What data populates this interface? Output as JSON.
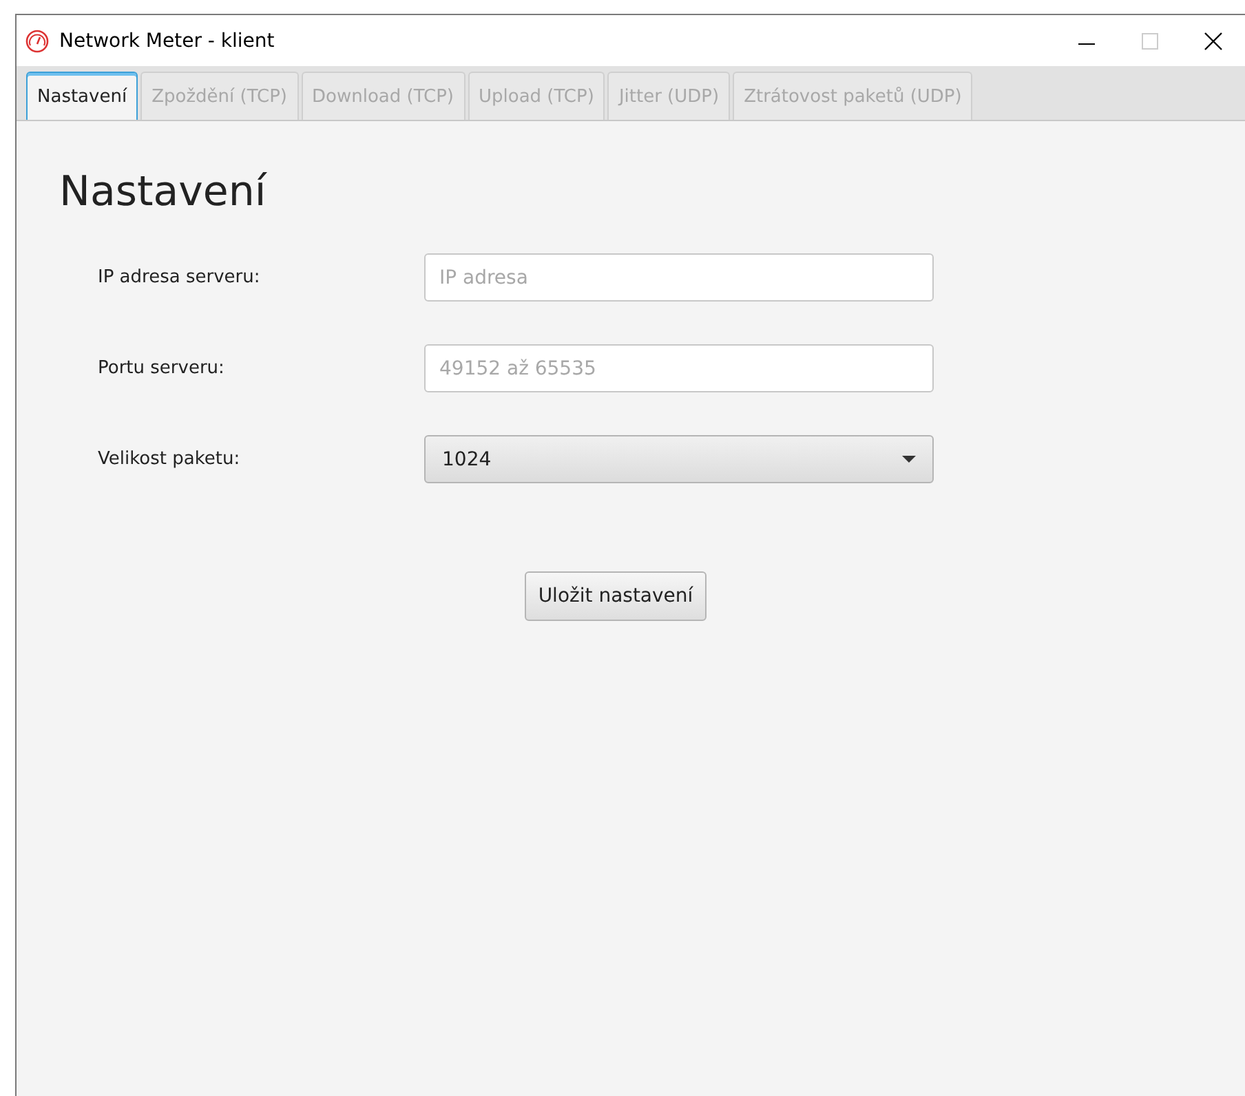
{
  "window": {
    "title": "Network Meter - klient"
  },
  "tabs": [
    {
      "label": "Nastavení",
      "selected": true,
      "disabled": false
    },
    {
      "label": "Zpoždění (TCP)",
      "selected": false,
      "disabled": true
    },
    {
      "label": "Download (TCP)",
      "selected": false,
      "disabled": true
    },
    {
      "label": "Upload (TCP)",
      "selected": false,
      "disabled": true
    },
    {
      "label": "Jitter (UDP)",
      "selected": false,
      "disabled": true
    },
    {
      "label": "Ztrátovost paketů (UDP)",
      "selected": false,
      "disabled": true
    }
  ],
  "heading": "Nastavení",
  "form": [
    {
      "kind": "text",
      "label": "IP adresa serveru:",
      "placeholder": "IP adresa"
    },
    {
      "kind": "text",
      "label": "Portu serveru:",
      "placeholder": "49152 až 65535"
    },
    {
      "kind": "select",
      "label": "Velikost paketu:",
      "value": "1024"
    }
  ],
  "save_button": "Uložit nastavení"
}
